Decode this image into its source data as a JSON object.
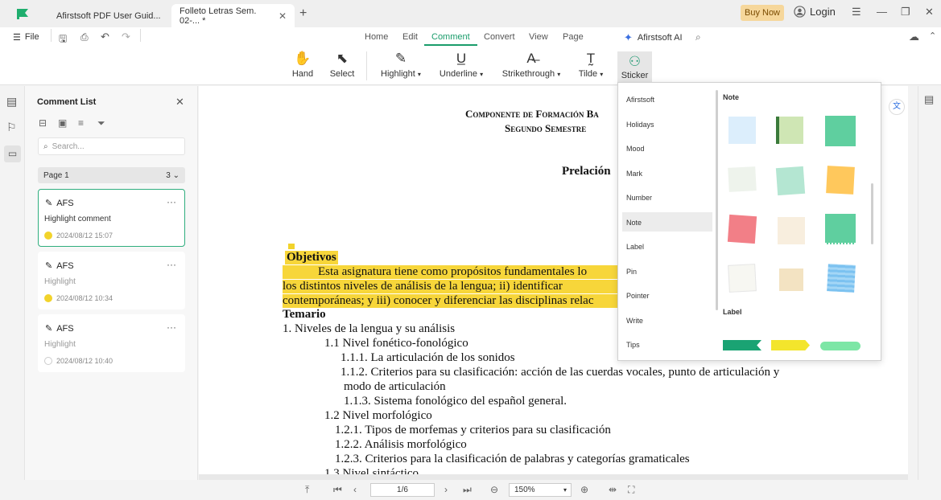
{
  "app": {
    "logo_color": "#1fae6e",
    "tabs": [
      {
        "label": "Afirstsoft PDF User Guid..."
      },
      {
        "label": "Folleto Letras Sem. 02-... *"
      }
    ],
    "buy_now": "Buy Now",
    "login": "Login"
  },
  "menu": {
    "file": "File",
    "items": [
      "Home",
      "Edit",
      "Comment",
      "Convert",
      "View",
      "Page"
    ],
    "ai": "Afirstsoft AI",
    "active": "Comment"
  },
  "toolbar": {
    "tools": [
      {
        "label": "Hand",
        "icon": "hand-icon"
      },
      {
        "label": "Select",
        "icon": "cursor-icon"
      },
      {
        "label": "Highlight",
        "icon": "highlight-icon"
      },
      {
        "label": "Underline",
        "icon": "underline-icon"
      },
      {
        "label": "Strikethrough",
        "icon": "strikethrough-icon"
      },
      {
        "label": "Tilde",
        "icon": "tilde-icon"
      },
      {
        "label": "Sticker",
        "icon": "sticker-icon"
      }
    ]
  },
  "comment_panel": {
    "title": "Comment List",
    "search_placeholder": "Search...",
    "page_label": "Page 1",
    "page_count": "3",
    "comments": [
      {
        "author": "AFS",
        "text": "Highlight comment",
        "date": "2024/08/12 15:07",
        "dot": "#f2d32b",
        "selected": true
      },
      {
        "author": "AFS",
        "text": "Highlight",
        "date": "2024/08/12 10:34",
        "dot": "#f2d32b",
        "selected": false
      },
      {
        "author": "AFS",
        "text": "Highlight",
        "date": "2024/08/12 10:40",
        "dot": "none",
        "selected": false
      }
    ]
  },
  "document": {
    "heading1": "Componente de Formación Ba",
    "heading2": "Segundo Semestre",
    "heading3": "Prelación",
    "objetivos": "Objetivos",
    "para1": "Esta asignatura tiene como propósitos fundamentales lo",
    "para2": "los distintos niveles de análisis de la lengua; ii) identificar",
    "para3": "contemporáneas; y iii) conocer y diferenciar las disciplinas relac",
    "temario": "Temario",
    "outline": [
      "1.     Niveles de la lengua y su análisis",
      "1.1  Nivel fonético-fonológico",
      "1.1.1. La articulación de los sonidos",
      "1.1.2. Criterios para su clasificación: acción de las cuerdas vocales, punto de articulación y",
      "modo de articulación",
      "1.1.3. Sistema fonológico del español general.",
      "1.2  Nivel morfológico",
      "1.2.1. Tipos de morfemas y criterios para su clasificación",
      "1.2.2. Análisis morfológico",
      "1.2.3. Criterios para la clasificación de palabras y categorías gramaticales",
      "1.3  Nivel sintáctico"
    ]
  },
  "sticker_popup": {
    "categories": [
      "Afirstsoft",
      "Holidays",
      "Mood",
      "Mark",
      "Number",
      "Note",
      "Label",
      "Pin",
      "Pointer",
      "Write",
      "Tips"
    ],
    "selected": "Note",
    "section_note": "Note",
    "section_label": "Label"
  },
  "statusbar": {
    "page": "1/6",
    "zoom": "150%"
  }
}
